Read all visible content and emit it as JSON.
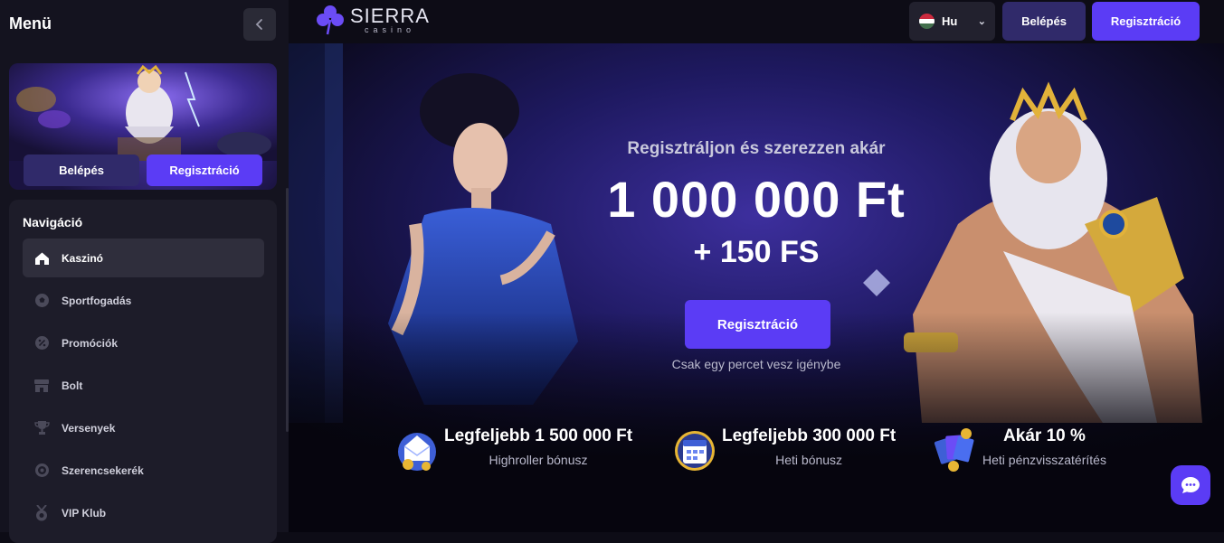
{
  "sidebar": {
    "title": "Menü",
    "collapse_icon": "chevron-left-icon",
    "login_label": "Belépés",
    "register_label": "Regisztráció",
    "nav_title": "Navigáció",
    "items": [
      {
        "label": "Kaszinó",
        "icon": "home-icon",
        "active": true
      },
      {
        "label": "Sportfogadás",
        "icon": "soccer-ball-icon",
        "active": false
      },
      {
        "label": "Promóciók",
        "icon": "percent-badge-icon",
        "active": false
      },
      {
        "label": "Bolt",
        "icon": "shop-icon",
        "active": false
      },
      {
        "label": "Versenyek",
        "icon": "trophy-icon",
        "active": false
      },
      {
        "label": "Szerencsekerék",
        "icon": "wheel-icon",
        "active": false
      },
      {
        "label": "VIP Klub",
        "icon": "medal-icon",
        "active": false
      }
    ]
  },
  "header": {
    "logo_main": "SIERRA",
    "logo_sub": "casino",
    "language": "Hu",
    "login_label": "Belépés",
    "register_label": "Regisztráció"
  },
  "hero": {
    "subtitle": "Regisztráljon és szerezzen akár",
    "amount": "1 000 000 Ft",
    "free_spins": "+ 150 FS",
    "cta_label": "Regisztráció",
    "note": "Csak egy percet vesz igénybe"
  },
  "bonuses": [
    {
      "title": "Legfeljebb 1 500 000 Ft",
      "desc": "Highroller bónusz",
      "icon": "money-envelope-icon"
    },
    {
      "title": "Legfeljebb 300 000 Ft",
      "desc": "Heti bónusz",
      "icon": "calendar-icon"
    },
    {
      "title": "Akár 10 %",
      "desc": "Heti pénzvisszatérítés",
      "icon": "cards-cashback-icon"
    }
  ],
  "colors": {
    "accent": "#5b3cf5",
    "sidebar_bg": "#14131f",
    "panel_bg": "#1d1c29",
    "dark_button": "#302a6a"
  }
}
